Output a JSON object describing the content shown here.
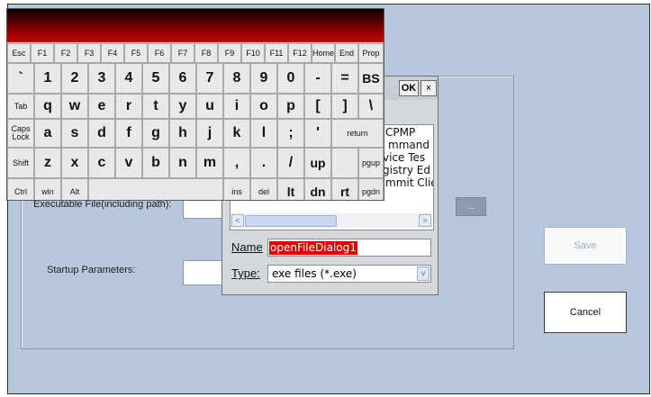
{
  "form": {
    "executable_label": "Executable File(including path):",
    "startup_label": "Startup Parameters:",
    "browse_label": "...",
    "save_label": "Save",
    "cancel_label": "Cancel"
  },
  "dialog": {
    "ok_label": "OK",
    "close_label": "×",
    "file_items": [
      "CPMP",
      "mmand",
      "vice Tes",
      "gistry Ed",
      "mmit Clie"
    ],
    "name_label": "Name",
    "name_value": "openFileDialog1",
    "type_label": "Type:",
    "type_value": "exe files (*.exe)",
    "scroll_left": "<",
    "scroll_right": ">",
    "dropdown_arrow": "v"
  },
  "keyboard": {
    "row_fn": [
      "Esc",
      "F1",
      "F2",
      "F3",
      "F4",
      "F5",
      "F6",
      "F7",
      "F8",
      "F9",
      "F10",
      "F11",
      "F12",
      "Home",
      "End",
      "Prop"
    ],
    "row_num": [
      "`",
      "1",
      "2",
      "3",
      "4",
      "5",
      "6",
      "7",
      "8",
      "9",
      "0",
      "-",
      "=",
      "BS"
    ],
    "row_q": [
      "Tab",
      "q",
      "w",
      "e",
      "r",
      "t",
      "y",
      "u",
      "i",
      "o",
      "p",
      "[",
      "]",
      "\\"
    ],
    "row_a": [
      "Caps Lock",
      "a",
      "s",
      "d",
      "f",
      "g",
      "h",
      "j",
      "k",
      "l",
      ";",
      "'",
      "return"
    ],
    "row_z": [
      "Shift",
      "z",
      "x",
      "c",
      "v",
      "b",
      "n",
      "m",
      ",",
      ".",
      "/",
      "up",
      "pgup"
    ],
    "row_ctrl": [
      "Ctrl",
      "win",
      "Alt",
      "ins",
      "del",
      "lt",
      "dn",
      "rt",
      "pgdn"
    ]
  },
  "colors": {
    "background": "#b7c8dc",
    "keyboard_title_gradient": "#d00000",
    "name_highlight": "#e00000"
  }
}
